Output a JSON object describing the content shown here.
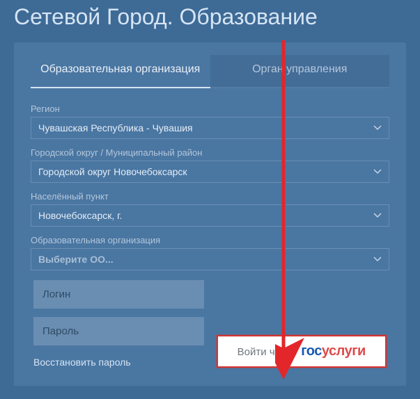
{
  "title": "Сетевой Город. Образование",
  "tabs": [
    {
      "label": "Образовательная организация",
      "active": true
    },
    {
      "label": "Орган управления",
      "active": false
    }
  ],
  "fields": {
    "region": {
      "label": "Регион",
      "value": "Чувашская Республика - Чувашия"
    },
    "district": {
      "label": "Городской округ / Муниципальный район",
      "value": "Городской округ Новочебоксарск"
    },
    "locality": {
      "label": "Населённый пункт",
      "value": "Новочебоксарск, г."
    },
    "org": {
      "label": "Образовательная организация",
      "value": "Выберите ОО..."
    }
  },
  "auth": {
    "login_placeholder": "Логин",
    "password_placeholder": "Пароль",
    "restore": "Восстановить пароль",
    "gosuslugi_pre": "Войти через",
    "gosuslugi_p1": "гос",
    "gosuslugi_p2": "услуги"
  }
}
